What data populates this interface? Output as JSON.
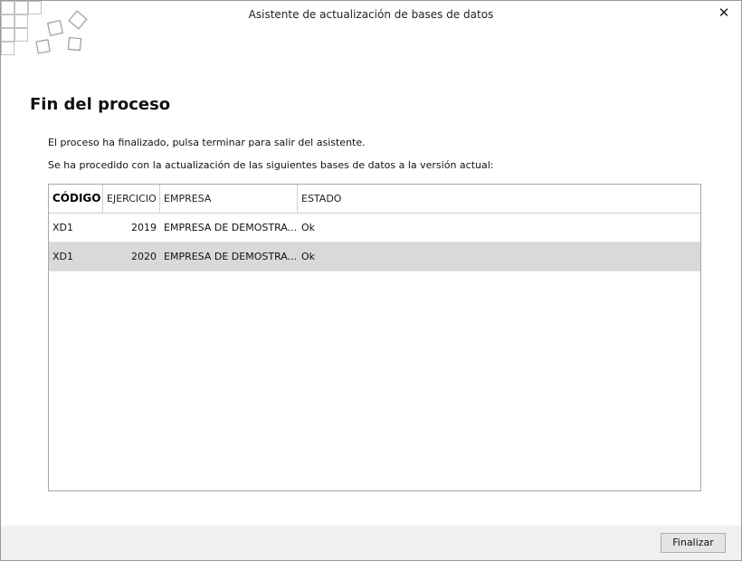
{
  "window": {
    "title": "Asistente de actualización de bases de datos",
    "close_glyph": "✕"
  },
  "page": {
    "heading": "Fin del proceso",
    "line1": "El proceso ha finalizado, pulsa terminar para salir del asistente.",
    "line2": "Se ha procedido con la actualización de las siguientes bases de datos a la versión actual:"
  },
  "table": {
    "columns": [
      "CÓDIGO",
      "EJERCICIO",
      "EMPRESA",
      "ESTADO"
    ],
    "rows": [
      [
        "XD1",
        "2019",
        "EMPRESA DE DEMOSTRA...",
        "Ok"
      ],
      [
        "XD1",
        "2020",
        "EMPRESA DE DEMOSTRA...",
        "Ok"
      ]
    ],
    "selected_row": 1
  },
  "footer": {
    "finish_label": "Finalizar"
  },
  "colors": {
    "selected_row": "#d9d9d9",
    "footer_bg": "#f0f0f0"
  },
  "icons": {
    "logo": "tile-cubes-logo",
    "close": "close-icon"
  }
}
